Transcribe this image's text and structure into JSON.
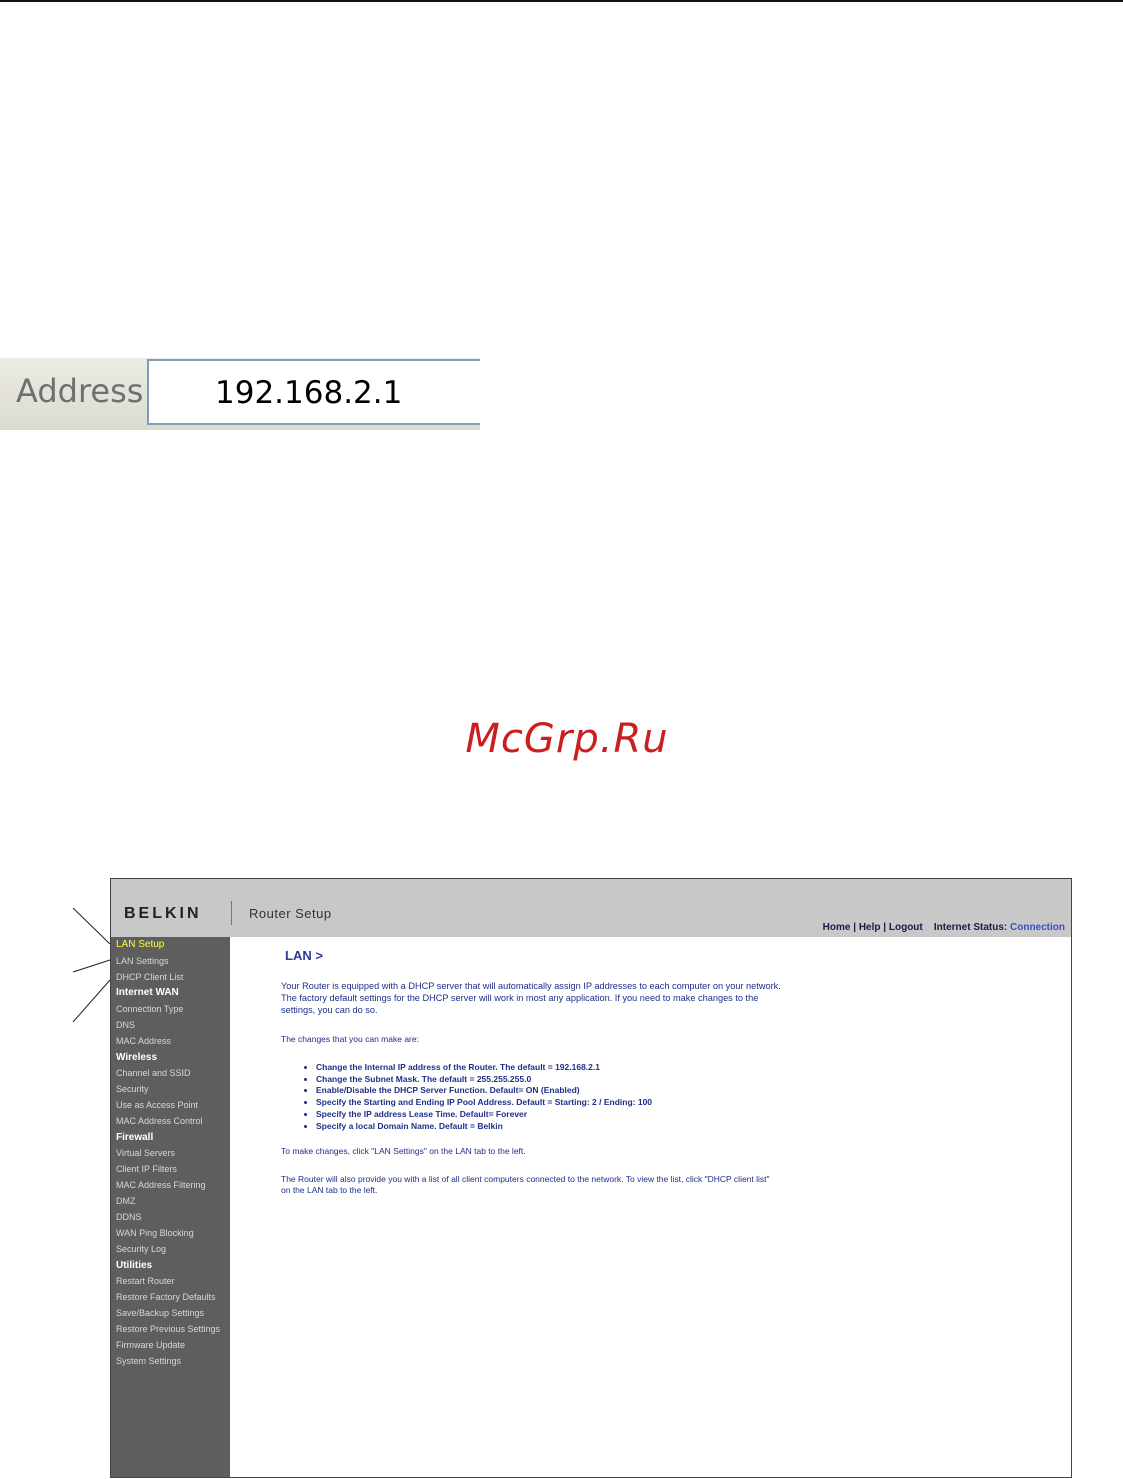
{
  "address_bar": {
    "label": "Address",
    "value": "192.168.2.1"
  },
  "watermark": "McGrp.Ru",
  "router": {
    "brand": "BELKIN",
    "title": "Router Setup",
    "top_links": {
      "home": "Home",
      "help": "Help",
      "logout": "Logout",
      "status_label": "Internet Status:",
      "status_value": "Connection"
    },
    "sidebar": {
      "lan_setup": "LAN Setup",
      "lan_items": [
        "LAN Settings",
        "DHCP Client List"
      ],
      "internet_wan": "Internet WAN",
      "wan_items": [
        "Connection Type",
        "DNS",
        "MAC Address"
      ],
      "wireless": "Wireless",
      "wireless_items": [
        "Channel and SSID",
        "Security",
        "Use as Access Point",
        "MAC Address Control"
      ],
      "firewall": "Firewall",
      "firewall_items": [
        "Virtual Servers",
        "Client IP Filters",
        "MAC Address Filtering",
        "DMZ",
        "DDNS",
        "WAN Ping Blocking",
        "Security Log"
      ],
      "utilities": "Utilities",
      "utilities_items": [
        "Restart Router",
        "Restore Factory Defaults",
        "Save/Backup Settings",
        "Restore Previous Settings",
        "Firmware Update",
        "System Settings"
      ]
    },
    "main": {
      "heading": "LAN >",
      "intro": "Your Router is equipped with a DHCP server that will automatically assign IP addresses to each computer on your network. The factory default settings for the DHCP server will work in most any application. If you need to make changes to the settings, you can do so.",
      "changes_label": "The changes that you can make are:",
      "bullets": [
        "Change the Internal IP address of the Router. The default = 192.168.2.1",
        "Change the Subnet Mask. The default = 255.255.255.0",
        "Enable/Disable the DHCP Server Function. Default= ON (Enabled)",
        "Specify the Starting and Ending IP Pool Address. Default = Starting: 2 / Ending: 100",
        "Specify the IP address Lease Time. Default= Forever",
        "Specify a local Domain Name. Default = Belkin"
      ],
      "to_make_changes": "To make changes, click \"LAN Settings\" on the LAN tab to the left.",
      "client_list_note": "The Router will also provide you with a list of all client computers connected to the network. To view the list, click \"DHCP client list\" on the LAN tab to the left."
    }
  }
}
